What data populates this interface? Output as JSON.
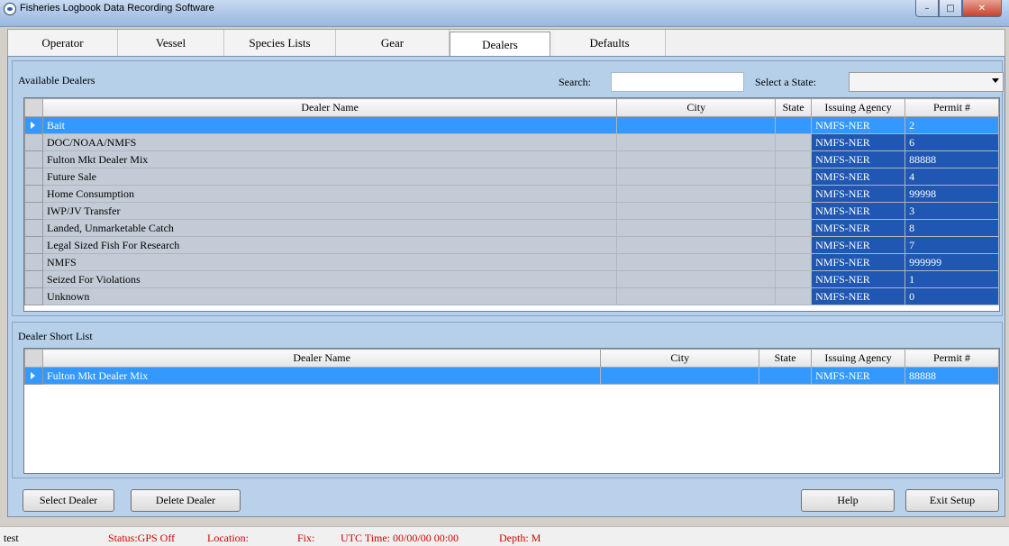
{
  "window": {
    "title": "Fisheries Logbook Data Recording Software"
  },
  "tabs": [
    "Operator",
    "Vessel",
    "Species Lists",
    "Gear",
    "Dealers",
    "Defaults"
  ],
  "active_tab": "Dealers",
  "available": {
    "label": "Available Dealers",
    "search_label": "Search:",
    "search_value": "",
    "state_label": "Select a State:",
    "state_value": "",
    "columns": [
      "Dealer Name",
      "City",
      "State",
      "Issuing Agency",
      "Permit #"
    ],
    "rows": [
      {
        "name": "Bait",
        "city": "",
        "state": "",
        "agency": "NMFS-NER",
        "permit": "2",
        "selected": true
      },
      {
        "name": "DOC/NOAA/NMFS",
        "city": "",
        "state": "",
        "agency": "NMFS-NER",
        "permit": "6"
      },
      {
        "name": "Fulton Mkt Dealer Mix",
        "city": "",
        "state": "",
        "agency": "NMFS-NER",
        "permit": "88888"
      },
      {
        "name": "Future Sale",
        "city": "",
        "state": "",
        "agency": "NMFS-NER",
        "permit": "4"
      },
      {
        "name": "Home Consumption",
        "city": "",
        "state": "",
        "agency": "NMFS-NER",
        "permit": "99998"
      },
      {
        "name": "IWP/JV Transfer",
        "city": "",
        "state": "",
        "agency": "NMFS-NER",
        "permit": "3"
      },
      {
        "name": "Landed, Unmarketable Catch",
        "city": "",
        "state": "",
        "agency": "NMFS-NER",
        "permit": "8"
      },
      {
        "name": "Legal Sized Fish For Research",
        "city": "",
        "state": "",
        "agency": "NMFS-NER",
        "permit": "7"
      },
      {
        "name": "NMFS",
        "city": "",
        "state": "",
        "agency": "NMFS-NER",
        "permit": "999999"
      },
      {
        "name": "Seized For Violations",
        "city": "",
        "state": "",
        "agency": "NMFS-NER",
        "permit": "1"
      },
      {
        "name": "Unknown",
        "city": "",
        "state": "",
        "agency": "NMFS-NER",
        "permit": "0"
      }
    ]
  },
  "shortlist": {
    "label": "Dealer Short List",
    "columns": [
      "Dealer Name",
      "City",
      "State",
      "Issuing Agency",
      "Permit #"
    ],
    "rows": [
      {
        "name": "Fulton Mkt Dealer Mix",
        "city": "",
        "state": "",
        "agency": "NMFS-NER",
        "permit": "88888",
        "selected": true
      }
    ]
  },
  "buttons": {
    "select_dealer": "Select Dealer",
    "delete_dealer": "Delete Dealer",
    "help": "Help",
    "exit_setup": "Exit Setup"
  },
  "status": {
    "user": "test",
    "gps": "Status:GPS Off",
    "location": "Location:",
    "fix": "Fix:",
    "utc": "UTC Time: 00/00/00 00:00",
    "depth": "Depth:  M"
  }
}
